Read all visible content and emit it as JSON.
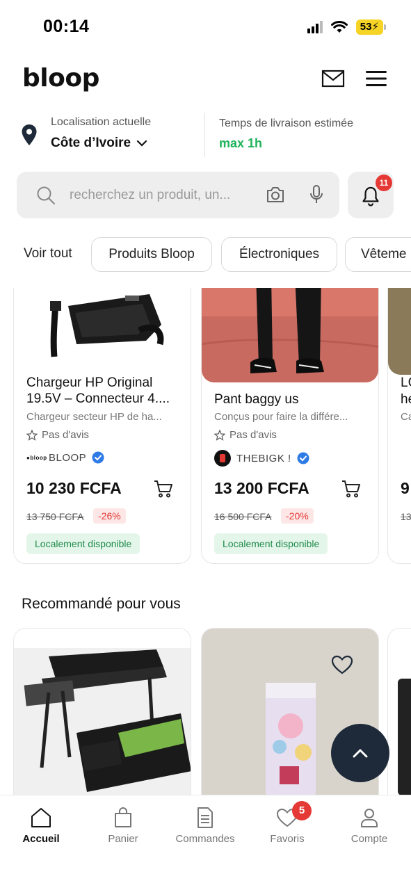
{
  "status_bar": {
    "time": "00:14",
    "battery": "53"
  },
  "header": {
    "logo": "bloop",
    "mail_icon": "mail-icon",
    "menu_icon": "hamburger-menu-icon"
  },
  "location": {
    "label": "Localisation actuelle",
    "value": "Côte d’Ivoire",
    "eta_label": "Temps de livraison estimée",
    "eta_value": "max 1h"
  },
  "search": {
    "placeholder": "recherchez un produit, un...",
    "notification_count": "11"
  },
  "categories": {
    "all": "Voir tout",
    "chips": [
      "Produits Bloop",
      "Électroniques",
      "Vêteme"
    ]
  },
  "products": [
    {
      "title": "Chargeur HP Original 19.5V – Connecteur 4....",
      "description": "Chargeur secteur HP de ha...",
      "rating": "Pas d'avis",
      "seller": "BLOOP",
      "price": "10 230 FCFA",
      "old_price": "13 750 FCFA",
      "discount": "-26%",
      "availability": "Localement disponible"
    },
    {
      "title": "Pant baggy us",
      "description": "Conçus pour faire la différe...",
      "rating": "Pas d'avis",
      "seller": "THEBIGK !",
      "price": "13 200 FCFA",
      "old_price": "16 500 FCFA",
      "discount": "-20%",
      "availability": "Localement disponible"
    },
    {
      "title": "LC",
      "title2": "he",
      "description": "Ca",
      "price": "9",
      "old_price": "13"
    }
  ],
  "recommended": {
    "title": "Recommandé pour vous"
  },
  "bottom_nav": {
    "items": [
      {
        "label": "Accueil"
      },
      {
        "label": "Panier"
      },
      {
        "label": "Commandes"
      },
      {
        "label": "Favoris",
        "badge": "5"
      },
      {
        "label": "Compte"
      }
    ]
  },
  "colors": {
    "accent_green": "#1fb25a",
    "badge_red": "#e53935",
    "verified_blue": "#2f7be5",
    "fab": "#1e2a3a"
  }
}
